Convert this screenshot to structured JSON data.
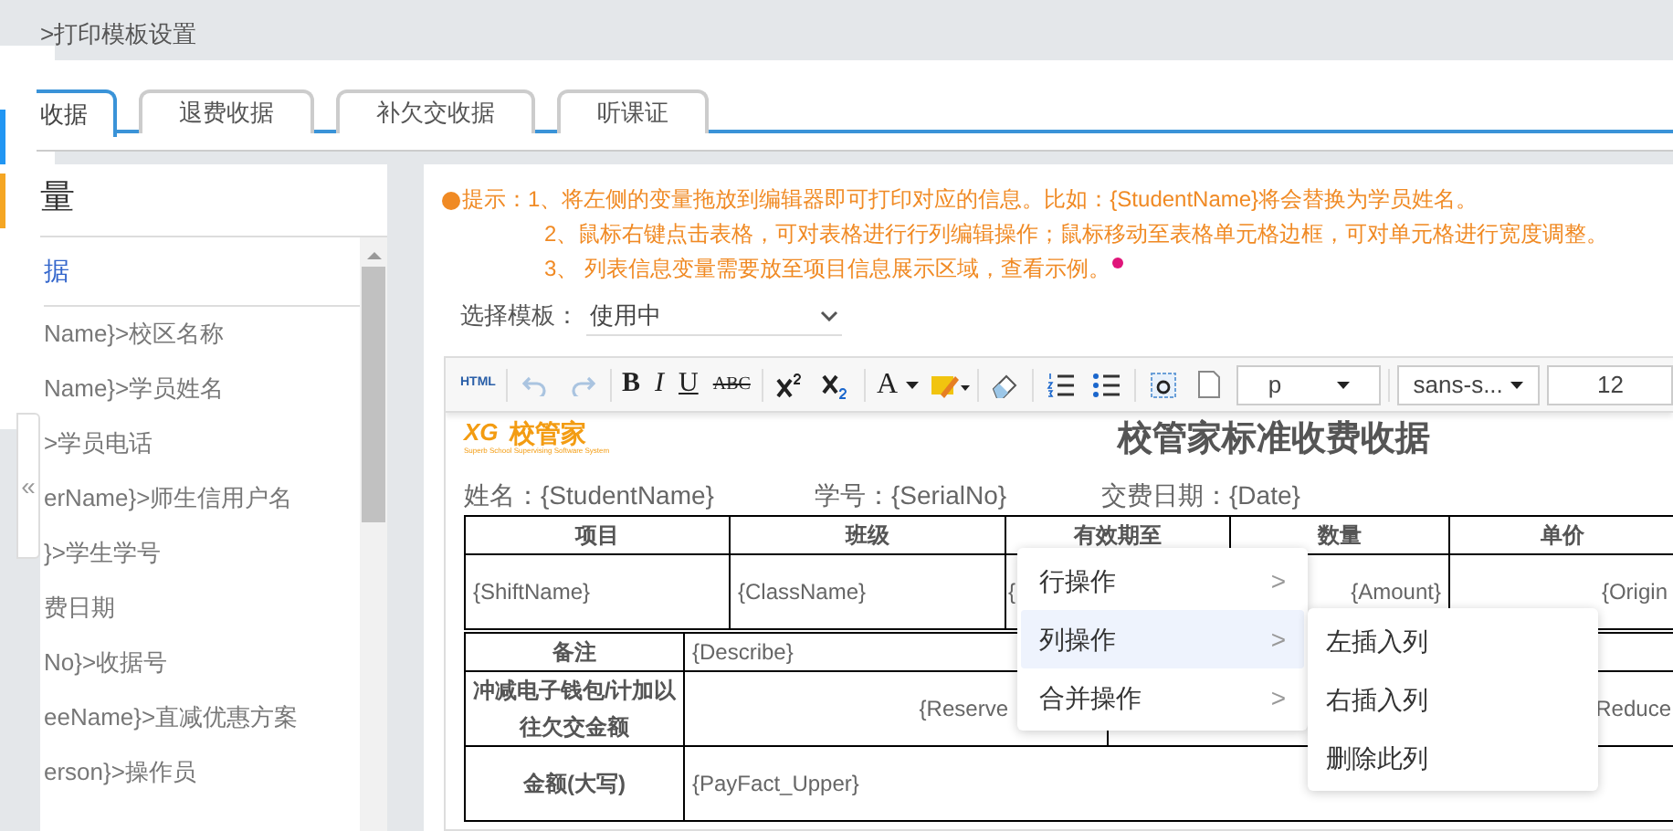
{
  "breadcrumb": ">打印模板设置",
  "tabs": [
    {
      "label": "收据",
      "selected": true
    },
    {
      "label": "退费收据",
      "selected": false
    },
    {
      "label": "补欠交收据",
      "selected": false
    },
    {
      "label": "听课证",
      "selected": false
    }
  ],
  "variables": {
    "title": "量",
    "group": "据",
    "collapse": "«",
    "items": [
      "Name}>校区名称",
      "Name}>学员姓名",
      ">学员电话",
      "erName}>师生信用户名",
      "}>学生学号",
      "费日期",
      "No}>收据号",
      "eeName}>直减优惠方案",
      "erson}>操作员"
    ]
  },
  "hints": [
    "提示：1、将左侧的变量拖放到编辑器即可打印对应的信息。比如：{StudentName}将会替换为学员姓名。",
    "2、鼠标右键点击表格，可对表格进行行列编辑操作；鼠标移动至表格单元格边框，可对单元格进行宽度调整。",
    "3、 列表信息变量需要放至项目信息展示区域，查看示例。"
  ],
  "template": {
    "label": "选择模板：",
    "value": "使用中"
  },
  "toolbar": {
    "labels": [
      "HTML",
      "B",
      "I",
      "U",
      "ABC",
      "A"
    ],
    "paragraph": "p",
    "font": "sans-s...",
    "size": "12"
  },
  "document": {
    "logo": "XG",
    "logo_name": "校管家",
    "logo_tagline": "Superb School Supervising Software System",
    "title": "校管家标准收费收据",
    "fields": [
      "姓名：{StudentName}",
      "学号：{SerialNo}",
      "交费日期：{Date}"
    ],
    "columns": [
      "项目",
      "班级",
      "有效期至",
      "数量",
      "单价"
    ],
    "row": [
      "{ShiftName}",
      "{ClassName}",
      "{",
      "{Amount}",
      "{Origin"
    ],
    "remark": {
      "label": "备注",
      "value": "{Describe}"
    },
    "offset": {
      "label": "冲减电子钱包/计加以往欠交金额",
      "value": "{Reserve",
      "value_2": "Reduce"
    },
    "amount": {
      "label": "金额(大写)",
      "value": "{PayFact_Upper}"
    }
  },
  "context_menu": {
    "items": [
      {
        "label": "行操作",
        "selected": false
      },
      {
        "label": "列操作",
        "selected": true
      },
      {
        "label": "合并操作",
        "selected": false
      }
    ],
    "arrow": ">",
    "submenu": [
      "左插入列",
      "右插入列",
      "删除此列"
    ]
  }
}
